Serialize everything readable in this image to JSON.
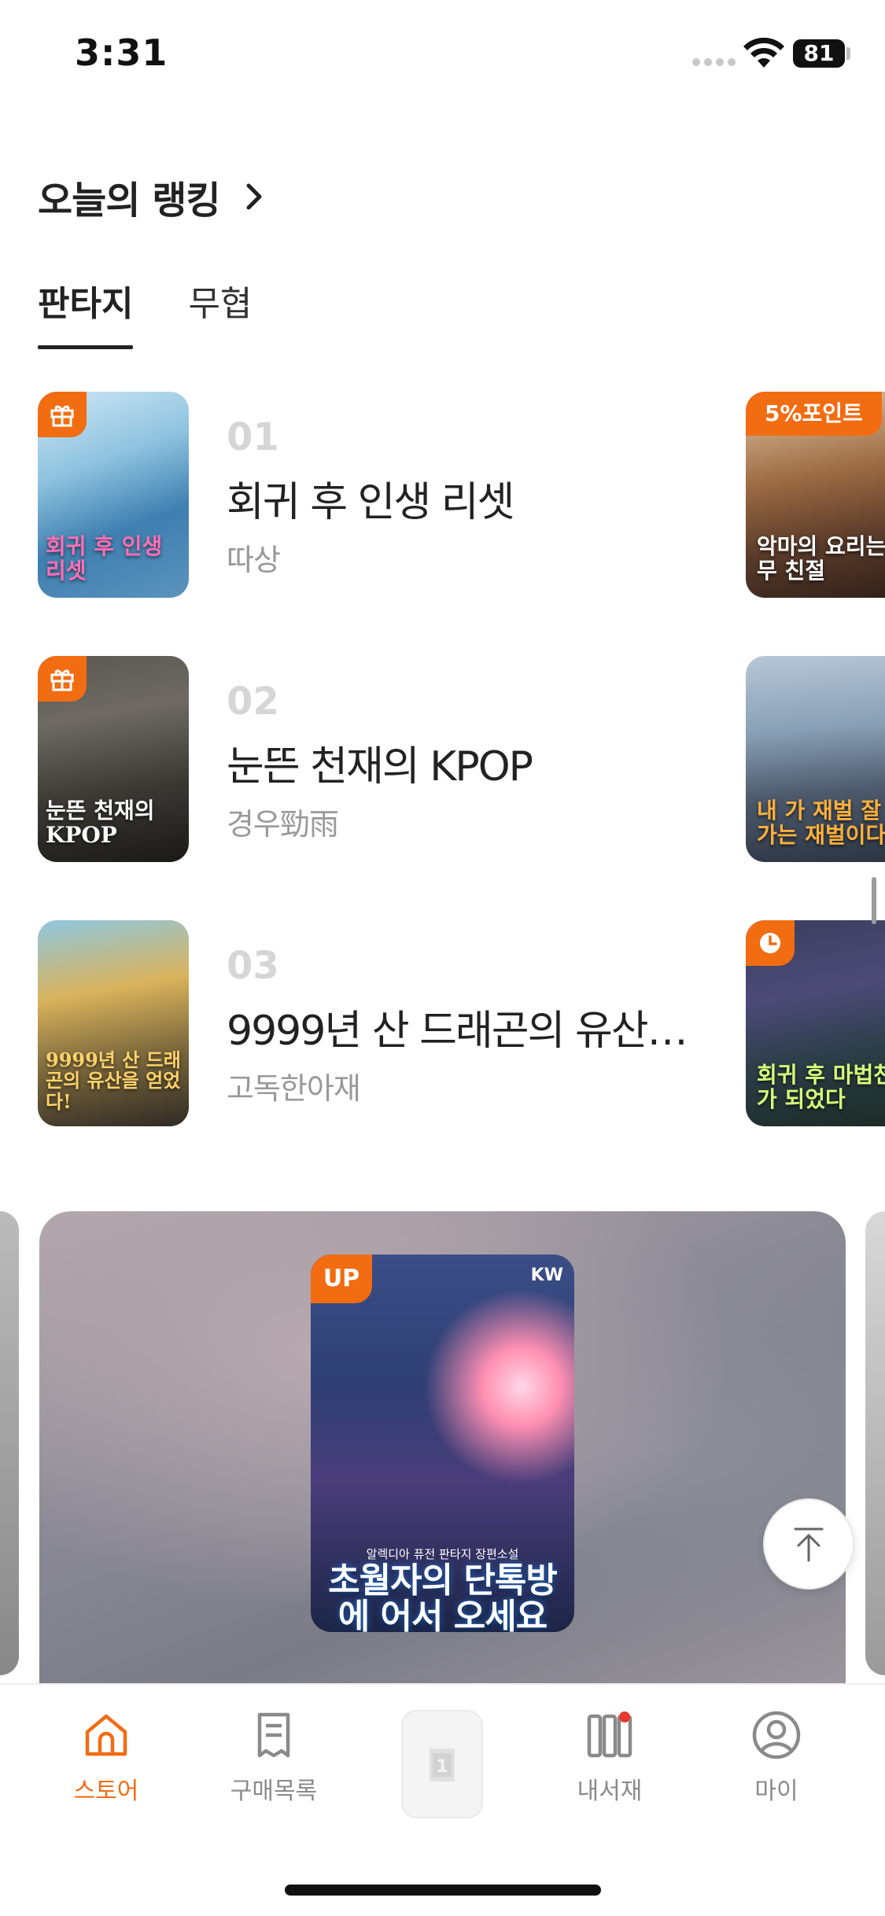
{
  "status_bar": {
    "time": "3:31",
    "battery": "81"
  },
  "section": {
    "title": "오늘의 랭킹"
  },
  "tabs": [
    {
      "label": "판타지",
      "active": true
    },
    {
      "label": "무협",
      "active": false
    }
  ],
  "rankings": [
    {
      "rank": "01",
      "title": "회귀 후 인생 리셋",
      "author": "따상",
      "badge": "gift-icon",
      "cover_text": "회귀 후 인생 리셋"
    },
    {
      "rank": "02",
      "title": "눈뜬 천재의 KPOP",
      "author": "경우勁雨",
      "badge": "gift-icon",
      "cover_text": "눈뜬 천재의 KPOP"
    },
    {
      "rank": "03",
      "title": "9999년 산 드래곤의 유산…",
      "author": "고독한아재",
      "badge": "none",
      "cover_text": "9999년 산 드래곤의 유산을 얻었다!"
    }
  ],
  "side_covers": [
    {
      "badge": "5%포인트",
      "cover_text": "악마의 요리는 너무 친절"
    },
    {
      "badge": "",
      "cover_text": "내 가 재벌 잘 나가는 재벌이다"
    },
    {
      "badge": "clock-icon",
      "cover_text": "회귀 후 마법천재가 되었다"
    }
  ],
  "banner": {
    "badge": "UP",
    "brand": "KW",
    "subtitle": "알렉디아 퓨전 판타지 장편소설",
    "title": "초월자의 단톡방에 어서 오세요"
  },
  "bottom_nav": [
    {
      "label": "스토어",
      "icon": "home-icon",
      "active": true
    },
    {
      "label": "구매목록",
      "icon": "receipt-icon",
      "active": false
    },
    {
      "label": "",
      "icon": "book-icon",
      "active": false
    },
    {
      "label": "내서재",
      "icon": "library-icon",
      "active": false
    },
    {
      "label": "마이",
      "icon": "profile-icon",
      "active": false
    }
  ],
  "colors": {
    "accent": "#f26c12",
    "text": "#222222",
    "muted": "#999999",
    "rank_number": "#d6d6d6"
  }
}
